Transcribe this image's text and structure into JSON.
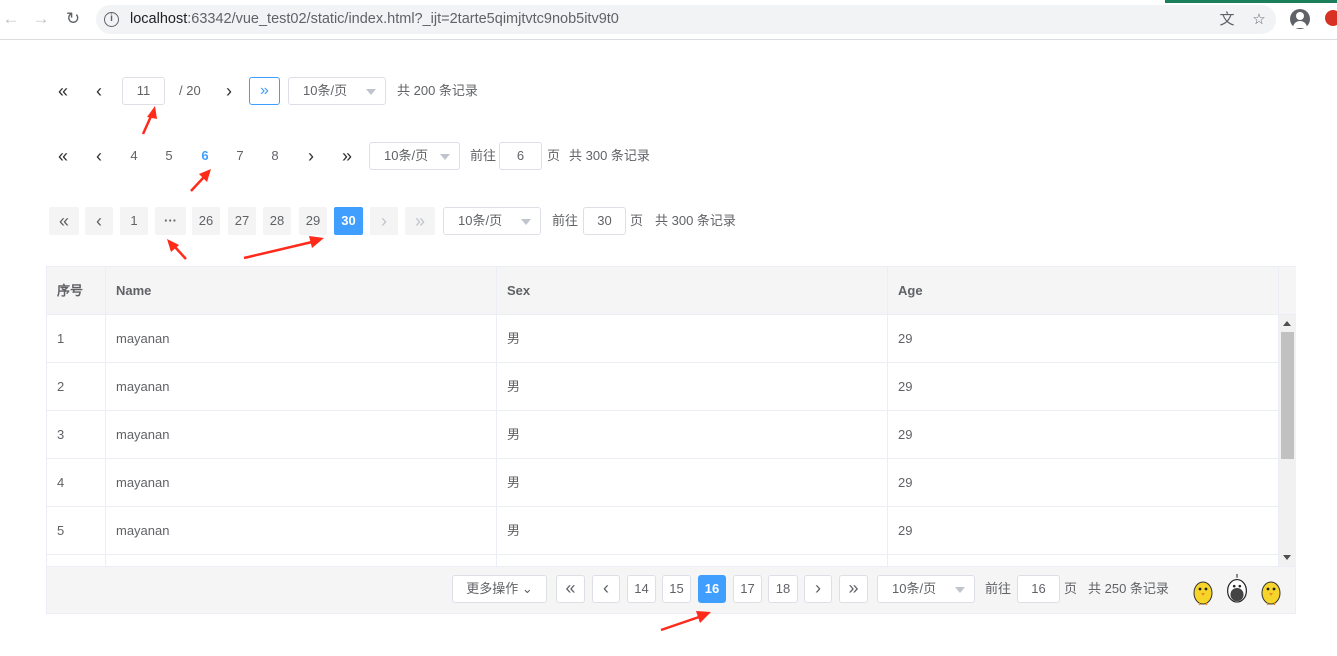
{
  "browser": {
    "url_host": "localhost",
    "url_rest": ":63342/vue_test02/static/index.html?_ijt=2tarte5qimjtvtc9nob5itv9t0"
  },
  "pager1": {
    "current": "11",
    "total_pages": "/ 20",
    "page_size": "10条/页",
    "total_text": "共 200 条记录"
  },
  "pager2": {
    "pages": [
      "4",
      "5",
      "6",
      "7",
      "8"
    ],
    "active": "6",
    "page_size": "10条/页",
    "goto_label": "前往",
    "goto_value": "6",
    "goto_unit": "页",
    "total_text": "共 300 条记录"
  },
  "pager3": {
    "first_page": "1",
    "ellipsis": "···",
    "pages": [
      "26",
      "27",
      "28",
      "29"
    ],
    "active": "30",
    "page_size": "10条/页",
    "goto_label": "前往",
    "goto_value": "30",
    "goto_unit": "页",
    "total_text": "共 300 条记录"
  },
  "table": {
    "columns": [
      "序号",
      "Name",
      "Sex",
      "Age"
    ],
    "rows": [
      [
        "1",
        "mayanan",
        "男",
        "29"
      ],
      [
        "2",
        "mayanan",
        "男",
        "29"
      ],
      [
        "3",
        "mayanan",
        "男",
        "29"
      ],
      [
        "4",
        "mayanan",
        "男",
        "29"
      ],
      [
        "5",
        "mayanan",
        "男",
        "29"
      ]
    ],
    "scroll_position": 0.0
  },
  "footer_pager": {
    "more_actions": "更多操作",
    "pages": [
      "14",
      "15"
    ],
    "active": "16",
    "pages_after": [
      "17",
      "18"
    ],
    "page_size": "10条/页",
    "goto_label": "前往",
    "goto_value": "16",
    "goto_unit": "页",
    "total_text": "共 250 条记录"
  },
  "colors": {
    "accent": "#409eff",
    "annotation": "#ff2a1a"
  }
}
